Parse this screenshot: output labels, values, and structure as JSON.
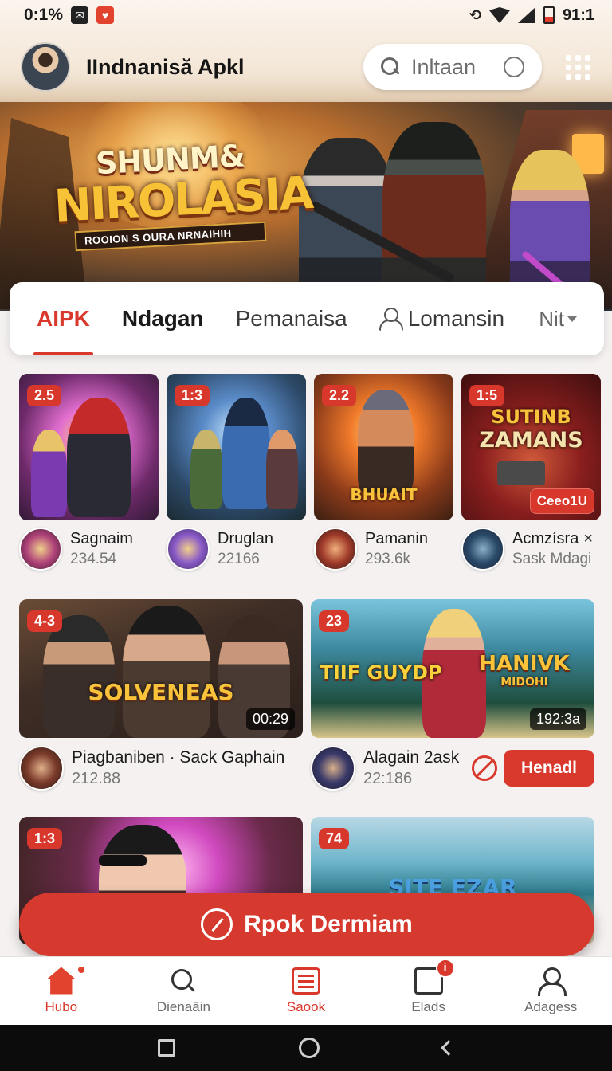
{
  "status_bar": {
    "time": "0:1%",
    "right_text": "91:1"
  },
  "header": {
    "app_title": "IIndnanisă Apkl",
    "search": {
      "placeholder": "Inltaan"
    }
  },
  "banner": {
    "title_line1": "SHUNM&",
    "title_line2": "NIROLASIA",
    "subtitle": "ROOION S OURA NRNAIHIH"
  },
  "tabs": [
    {
      "label": "AIPK",
      "active": true
    },
    {
      "label": "Ndagan"
    },
    {
      "label": "Pemanaisa"
    },
    {
      "label": "Lomansin"
    },
    {
      "label": "Nit"
    }
  ],
  "games_row": [
    {
      "badge": "2.5",
      "name": "Sagnaim",
      "count": "234.54"
    },
    {
      "badge": "1:3",
      "name": "Druglan",
      "count": "22166"
    },
    {
      "badge": "2.2",
      "name": "Pamanin",
      "count": "293.6k",
      "thumb_title": "BHUAIT"
    },
    {
      "badge": "1:5",
      "name": "Acmzísra",
      "count": "Sask Mdagi",
      "thumb_title_1": "SUTINB",
      "thumb_title_2": "ZAMANS",
      "tag": "Ceeo1U",
      "close": "×"
    }
  ],
  "video_row": [
    {
      "badge": "4-3",
      "duration": "00:29",
      "thumb_title": "SOLVENEAS",
      "name": "Piagbaniben · Sack Gaphain",
      "count": "212.88"
    },
    {
      "badge": "23",
      "duration": "192:3a",
      "thumb_title_1": "TIIF GUYDP",
      "thumb_title_2": "HANIVK",
      "thumb_title_3": "MIDOHI",
      "name": "Alagain 2ask",
      "count": "22:186",
      "action": "Henadl"
    }
  ],
  "partial_row": [
    {
      "badge": "1:3"
    },
    {
      "badge": "74",
      "thumb_title": "SITE EZAR"
    }
  ],
  "cta": {
    "label": "Rpok Dermiam"
  },
  "bottom_nav": [
    {
      "label": "Hubo",
      "icon": "home-icon",
      "active": true
    },
    {
      "label": "Dienaāin",
      "icon": "search-icon"
    },
    {
      "label": "Saook",
      "icon": "list-icon",
      "active": true
    },
    {
      "label": "Elads",
      "icon": "inbox-icon",
      "badge": "i"
    },
    {
      "label": "Adagess",
      "icon": "person-icon"
    }
  ],
  "colors": {
    "accent": "#d9382c",
    "background": "#f4f1f0"
  }
}
